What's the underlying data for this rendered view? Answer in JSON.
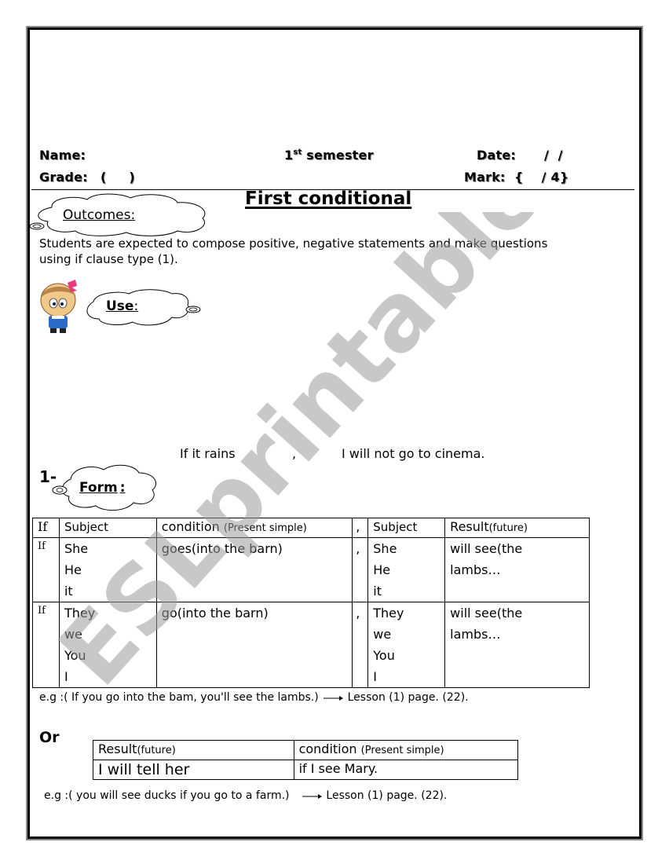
{
  "header": {
    "name_label": "Name:",
    "semester_num": "1",
    "semester_sup": "st",
    "semester_word": "semester",
    "date_label": "Date:",
    "date_value": "/  /",
    "grade_label": "Grade:",
    "grade_value": "(     )",
    "mark_label": "Mark:",
    "mark_value": "{    / 4}"
  },
  "title": "First conditional",
  "outcomes": {
    "label": "Outcomes:",
    "text_line1": "Students are expected to compose positive, negative statements and make questions",
    "text_line2": "using if clause type (1)."
  },
  "use": {
    "label": "Use",
    "colon": ":",
    "example": {
      "part1": "If it rains",
      "comma": ",",
      "part2": "I will not go to cinema."
    }
  },
  "form": {
    "number": "1-",
    "label": "Form",
    "colon": ":",
    "table": {
      "headers": {
        "if": "If",
        "subject": "Subject",
        "condition": "condition",
        "condition_note": "(Present simple)",
        "comma": ",",
        "subject2": "Subject",
        "result": "Result",
        "result_note": "(future)"
      },
      "rows": [
        {
          "if": "If",
          "subjects": [
            "She",
            "He",
            "it"
          ],
          "condition": "goes(into the barn)",
          "comma": ",",
          "subjects2": [
            "She",
            "He",
            "it"
          ],
          "result_line1": "will see(the",
          "result_line2": "lambs…"
        },
        {
          "if": "If",
          "subjects": [
            "They",
            "we",
            "You",
            "I"
          ],
          "condition": "go(into the barn)",
          "comma": ",",
          "subjects2": [
            "They",
            "we",
            "You",
            "I"
          ],
          "result_line1": "will see(the",
          "result_line2": "lambs…"
        }
      ]
    },
    "example": {
      "text": "e.g :( If you go into the bam, you'll see the lambs.)",
      "ref": "Lesson (1) page. (22)."
    }
  },
  "or_section": {
    "label": "Or",
    "table": {
      "header_result": "Result",
      "header_result_note": "(future)",
      "header_condition": "condition",
      "header_condition_note": "(Present simple)",
      "cell_result": "I will tell her",
      "cell_condition": "if I see Mary."
    },
    "example": {
      "text": "e.g :( you will see ducks if you go to a farm.)",
      "ref": "Lesson (1) page. (22)."
    }
  },
  "watermark": "ESLprintables.com"
}
